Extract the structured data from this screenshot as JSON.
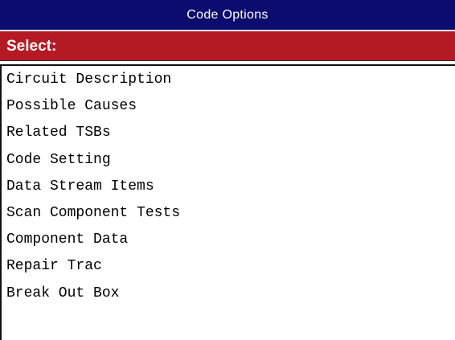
{
  "window": {
    "title": "Code Options"
  },
  "header": {
    "label": "Select:"
  },
  "options": [
    "Circuit Description",
    "Possible Causes",
    "Related TSBs",
    "Code Setting",
    "Data Stream Items",
    "Scan Component Tests",
    "Component Data",
    "Repair Trac",
    "Break Out Box"
  ],
  "colors": {
    "title_bar": "#0c0b6e",
    "header_bar": "#b41a24",
    "list_background": "#ffffff",
    "text": "#000000"
  }
}
